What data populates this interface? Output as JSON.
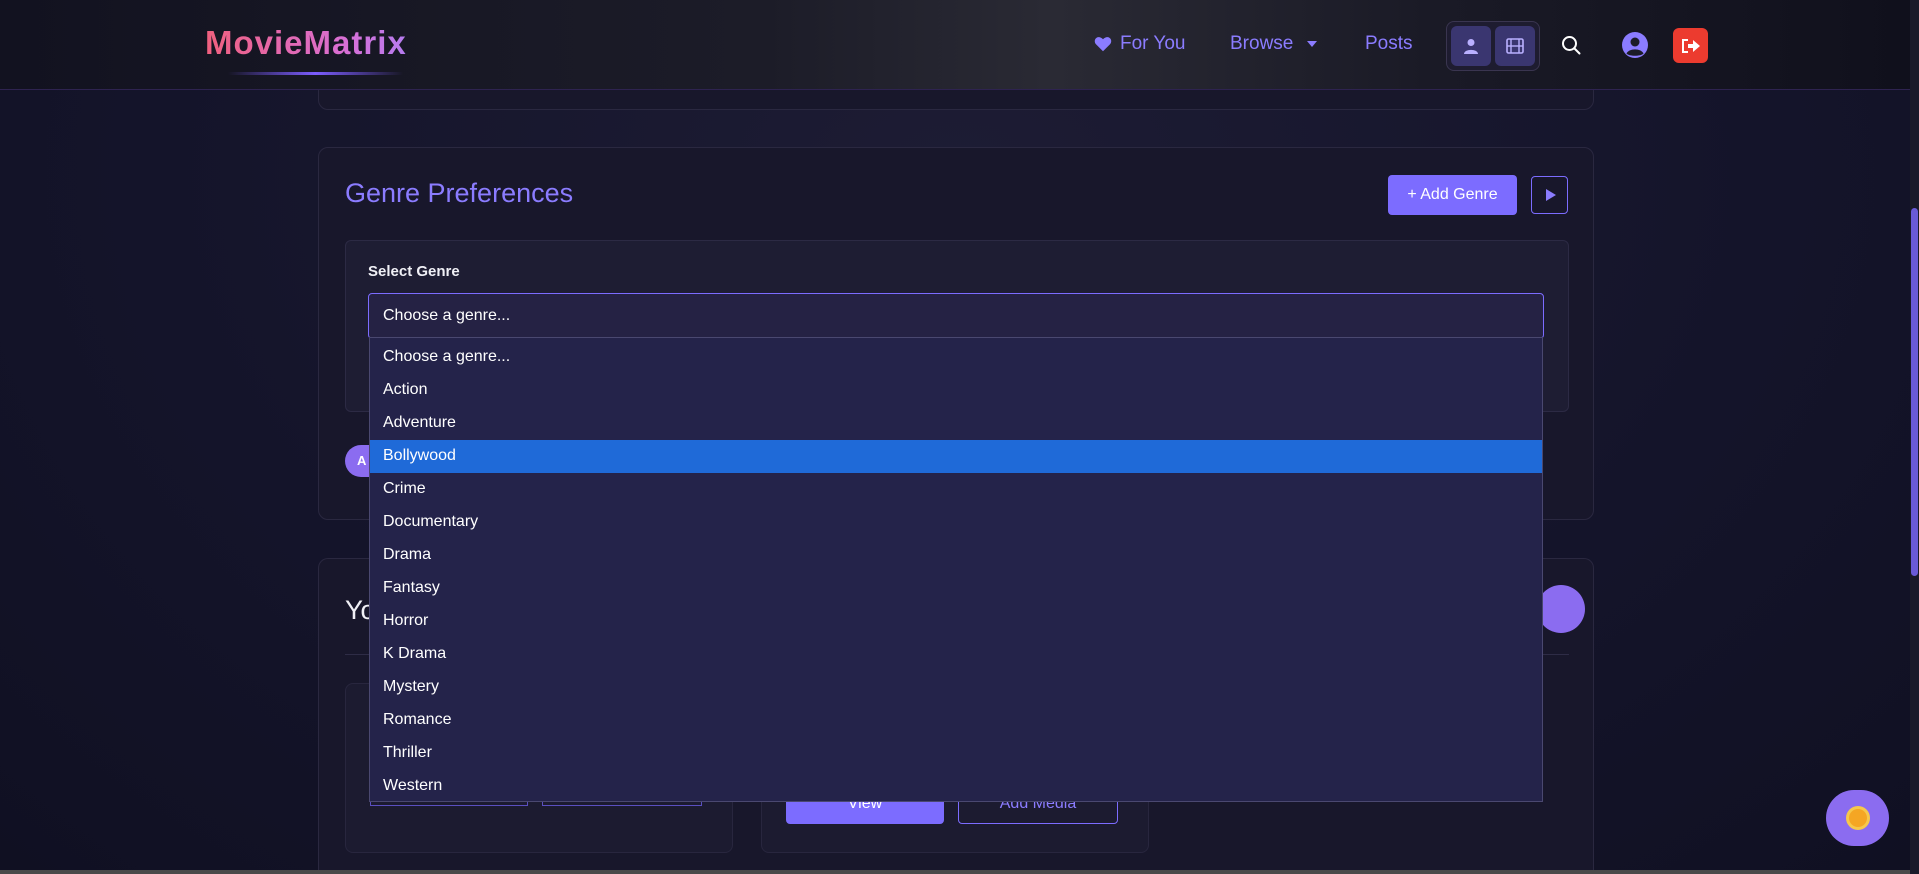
{
  "header": {
    "logo": "MovieMatrix",
    "nav": {
      "for_you": "For You",
      "browse": "Browse",
      "posts": "Posts"
    },
    "icons": [
      "heart-icon",
      "user-icon",
      "film-icon",
      "search-icon",
      "user-circle-icon",
      "logout-icon"
    ]
  },
  "genre_preferences": {
    "title": "Genre Preferences",
    "add_button": "+ Add Genre",
    "select_label": "Select Genre",
    "select_value": "Choose a genre...",
    "chip_partial": "A",
    "options": [
      "Choose a genre...",
      "Action",
      "Adventure",
      "Bollywood",
      "Crime",
      "Documentary",
      "Drama",
      "Fantasy",
      "Horror",
      "K Drama",
      "Mystery",
      "Romance",
      "Thriller",
      "Western"
    ],
    "highlighted_option": "Bollywood"
  },
  "yours_section": {
    "title_partial": "Yo",
    "view_button": "View",
    "add_media_button": "Add Media"
  },
  "colors": {
    "accent": "#7c6cff",
    "highlight": "#1f6ad8",
    "logout": "#ec3b2f"
  }
}
